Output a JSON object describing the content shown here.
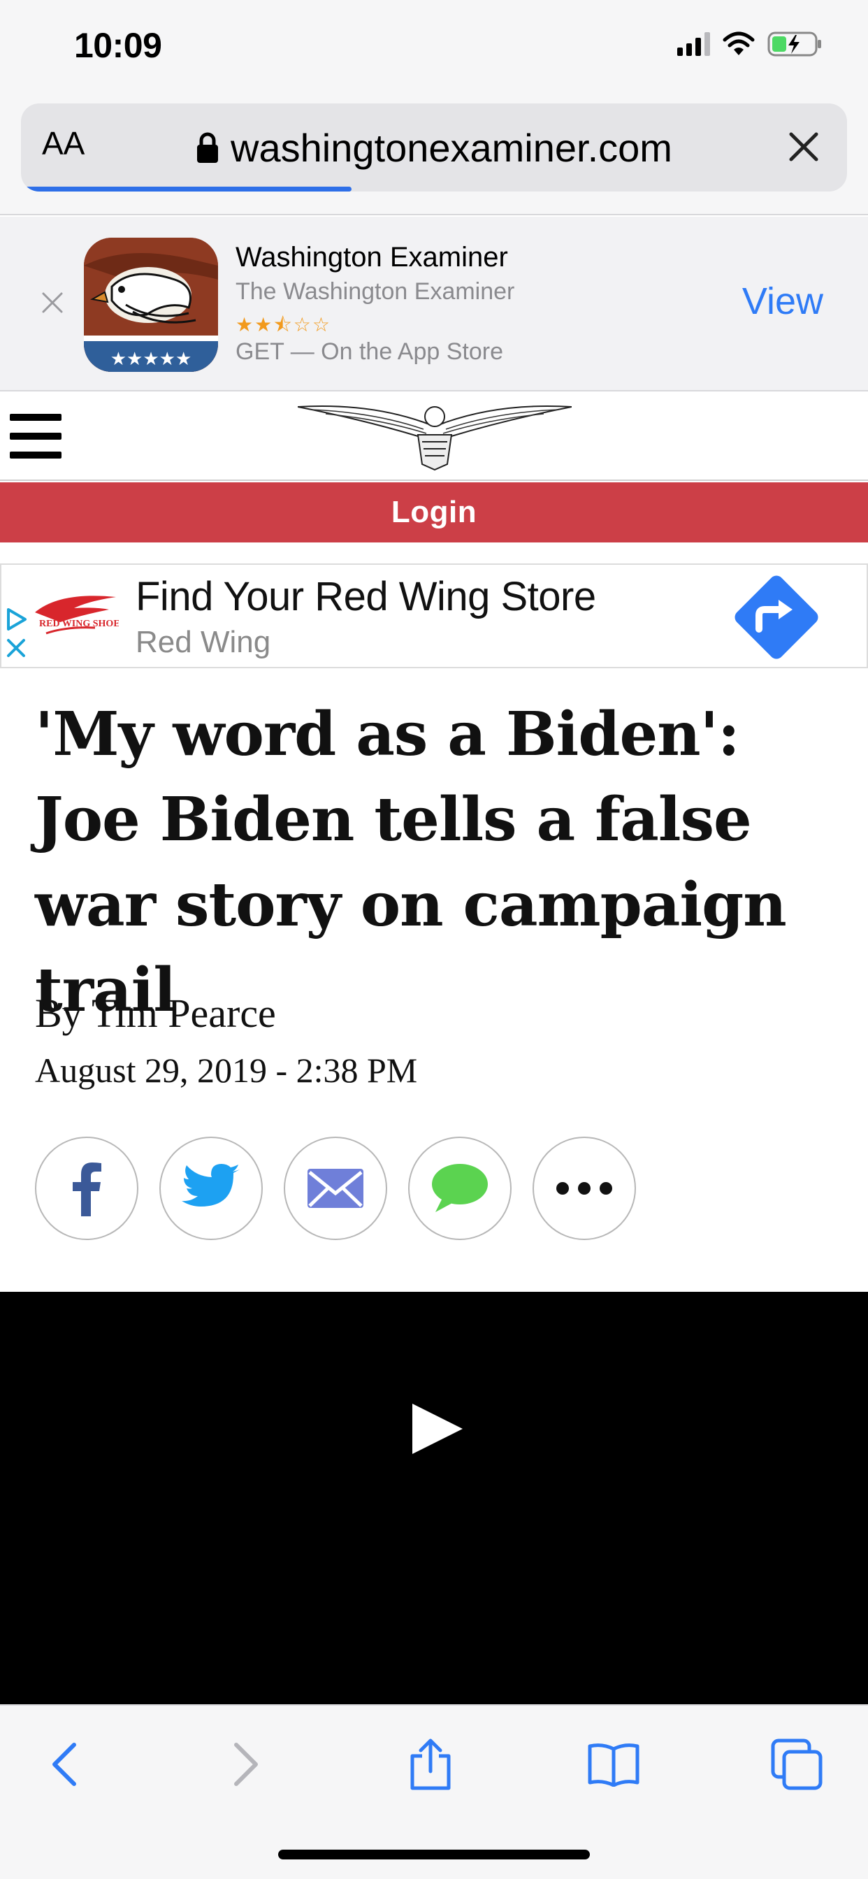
{
  "status_bar": {
    "time": "10:09"
  },
  "address_bar": {
    "text_size_label": "AA",
    "url": "washingtonexaminer.com",
    "load_progress": 0.4
  },
  "app_banner": {
    "app_name": "Washington Examiner",
    "publisher": "The Washington Examiner",
    "rating_stars": "★★⯪☆☆",
    "rating_value": 2.5,
    "store_text": "GET — On the App Store",
    "view_label": "View"
  },
  "site_header": {
    "login_label": "Login"
  },
  "ad": {
    "title": "Find Your Red Wing Store",
    "advertiser": "Red Wing",
    "logo_text": "RED WING SHOES"
  },
  "article": {
    "headline": "'My word as a Biden': Joe Biden tells a false war story on campaign trail",
    "byline": "By Tim Pearce",
    "date": "August 29, 2019 - 2:38 PM"
  },
  "share_buttons": [
    {
      "name": "facebook",
      "color": "#3b5998"
    },
    {
      "name": "twitter",
      "color": "#1da1f2"
    },
    {
      "name": "email",
      "color": "#6f7fd9"
    },
    {
      "name": "messages",
      "color": "#5bd350"
    },
    {
      "name": "more",
      "color": "#111111"
    }
  ],
  "colors": {
    "accent_blue": "#2f7bf6",
    "login_red": "#cc3f47",
    "video_bg": "#000000"
  }
}
